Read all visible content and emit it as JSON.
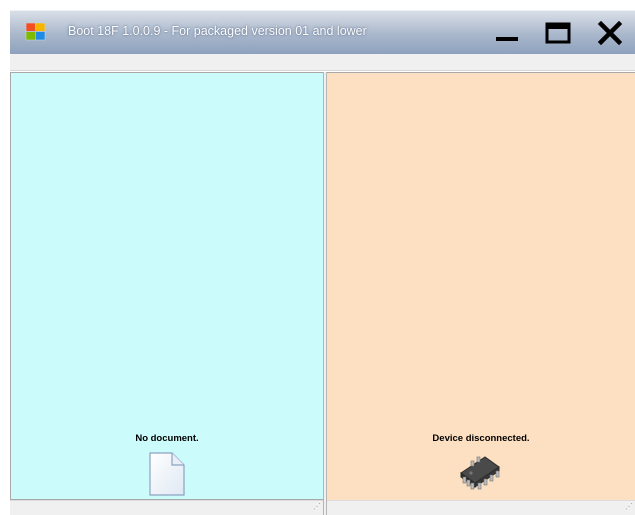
{
  "window": {
    "title": "Boot 18F 1.0.0.9 - For packaged version 01 and lower",
    "app_icon": "windows-app-icon",
    "controls": [
      {
        "name": "minimize-button",
        "icon": "minimize-icon"
      },
      {
        "name": "maximize-button",
        "icon": "maximize-icon"
      },
      {
        "name": "close-button",
        "icon": "close-icon"
      }
    ]
  },
  "left_pane": {
    "background": "#ccfbfb",
    "status": "No document.",
    "icon": "document-icon"
  },
  "right_pane": {
    "background": "#fde0c2",
    "status": "Device disconnected.",
    "icon": "chip-icon"
  }
}
